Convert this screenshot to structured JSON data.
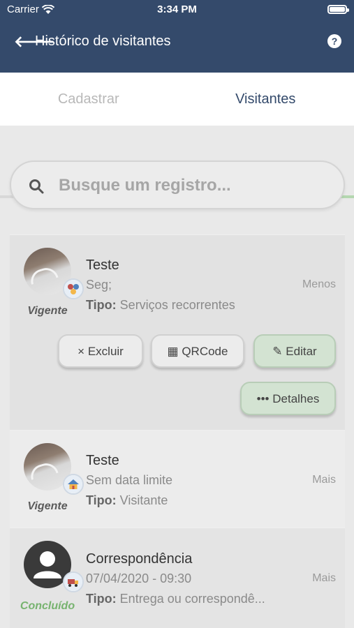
{
  "status_bar": {
    "carrier": "Carrier",
    "time": "3:34 PM"
  },
  "header": {
    "title": "Histórico de visitantes",
    "back_icon": "arrow-left-icon",
    "help_icon": "question-icon"
  },
  "tabs": [
    {
      "label": "Cadastrar",
      "active": false
    },
    {
      "label": "Visitantes",
      "active": true
    }
  ],
  "search": {
    "placeholder": "Busque um registro..."
  },
  "records": [
    {
      "name": "Teste",
      "date": "Seg;",
      "tipo_label": "Tipo:",
      "tipo": "Serviços recorrentes",
      "status": "Vigente",
      "toggle": "Menos",
      "expanded": true,
      "actions": {
        "delete": {
          "icon": "×",
          "label": "Excluir"
        },
        "qrcode": {
          "icon": "▦",
          "label": "QRCode"
        },
        "edit": {
          "icon": "✎",
          "label": "Editar"
        },
        "details": {
          "icon": "•••",
          "label": "Detalhes"
        }
      }
    },
    {
      "name": "Teste",
      "date": "Sem data limite",
      "tipo_label": "Tipo:",
      "tipo": "Visitante",
      "status": "Vigente",
      "toggle": "Mais"
    },
    {
      "name": "Correspondência",
      "date": "07/04/2020 - 09:30",
      "tipo_label": "Tipo:",
      "tipo": "Entrega ou correspondê...",
      "status": "Concluído",
      "toggle": "Mais"
    }
  ],
  "colors": {
    "header": "#344a6b",
    "active_tab": "#344a6b",
    "tab_indicator": "#b4d7b0",
    "concluido": "#77b36f"
  }
}
